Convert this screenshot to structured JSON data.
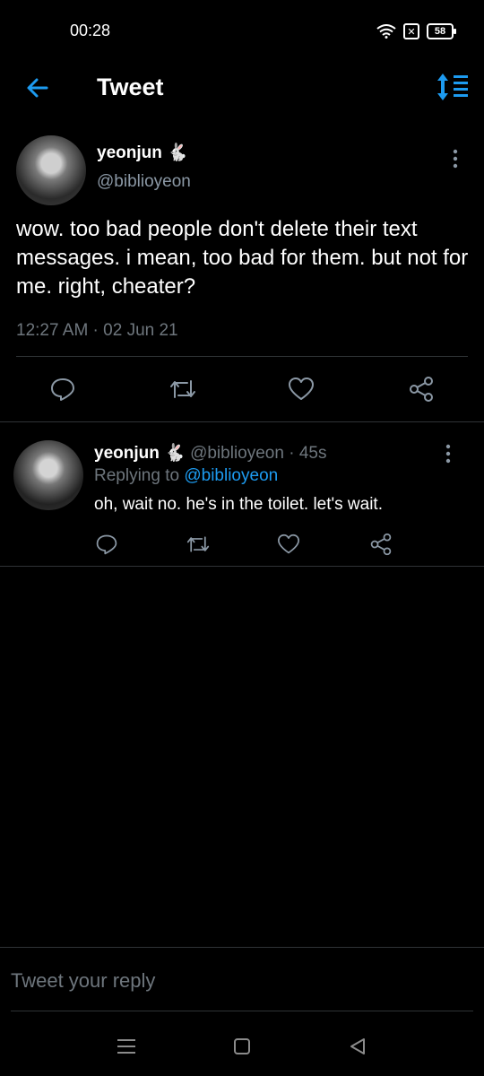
{
  "status_bar": {
    "time": "00:28",
    "battery": "58",
    "icons": [
      "wifi-icon",
      "box-x-icon",
      "battery-icon"
    ]
  },
  "header": {
    "title": "Tweet",
    "back_icon": "arrow-left-icon",
    "sort_icon": "sort-icon"
  },
  "colors": {
    "accent": "#1d9bf0",
    "muted": "#6e767d",
    "divider": "#2f3336",
    "background": "#000000"
  },
  "main_tweet": {
    "name": "yeonjun",
    "name_emoji": "🐇",
    "handle": "@biblioyeon",
    "text": "wow. too bad people don't delete their text messages. i mean, too bad for them. but not for me. right, cheater?",
    "timestamp": "12:27 AM · 02 Jun 21",
    "actions": [
      "reply-icon",
      "retweet-icon",
      "like-icon",
      "share-icon"
    ]
  },
  "reply": {
    "name": "yeonjun",
    "name_emoji": "🐇",
    "meta": "@biblioyeon · 45s",
    "replying_prefix": "Replying to",
    "replying_to": "@biblioyeon",
    "text": "oh, wait no. he's in the toilet. let's wait.",
    "actions": [
      "reply-icon",
      "retweet-icon",
      "like-icon",
      "share-icon"
    ]
  },
  "composer": {
    "placeholder": "Tweet your reply"
  },
  "nav_bar": {
    "icons": [
      "menu-icon",
      "home-icon",
      "back-icon"
    ]
  }
}
